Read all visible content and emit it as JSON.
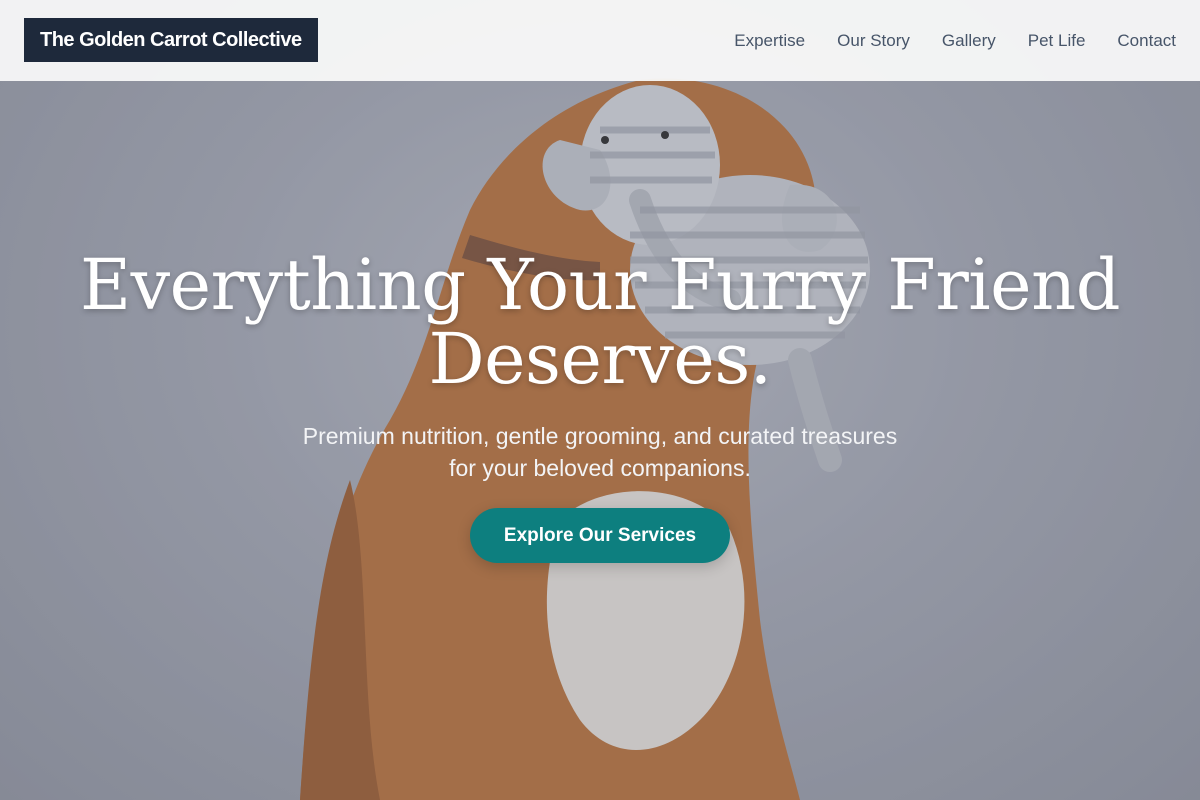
{
  "brand": {
    "name": "The Golden Carrot Collective"
  },
  "nav": {
    "items": [
      {
        "label": "Expertise"
      },
      {
        "label": "Our Story"
      },
      {
        "label": "Gallery"
      },
      {
        "label": "Pet Life"
      },
      {
        "label": "Contact"
      }
    ]
  },
  "hero": {
    "title_line1": "Everything Your Furry Friend",
    "title_line2": "Deserves.",
    "subtitle_line1": "Premium nutrition, gentle grooming, and curated treasures",
    "subtitle_line2": "for your beloved companions.",
    "cta_label": "Explore Our Services",
    "image_subject": "dog-holding-plush-elephant-photo"
  },
  "colors": {
    "logo_bg": "#1e293b",
    "nav_text": "#475569",
    "cta_bg": "#0d7f7f",
    "header_bg": "#f8f8f8"
  }
}
